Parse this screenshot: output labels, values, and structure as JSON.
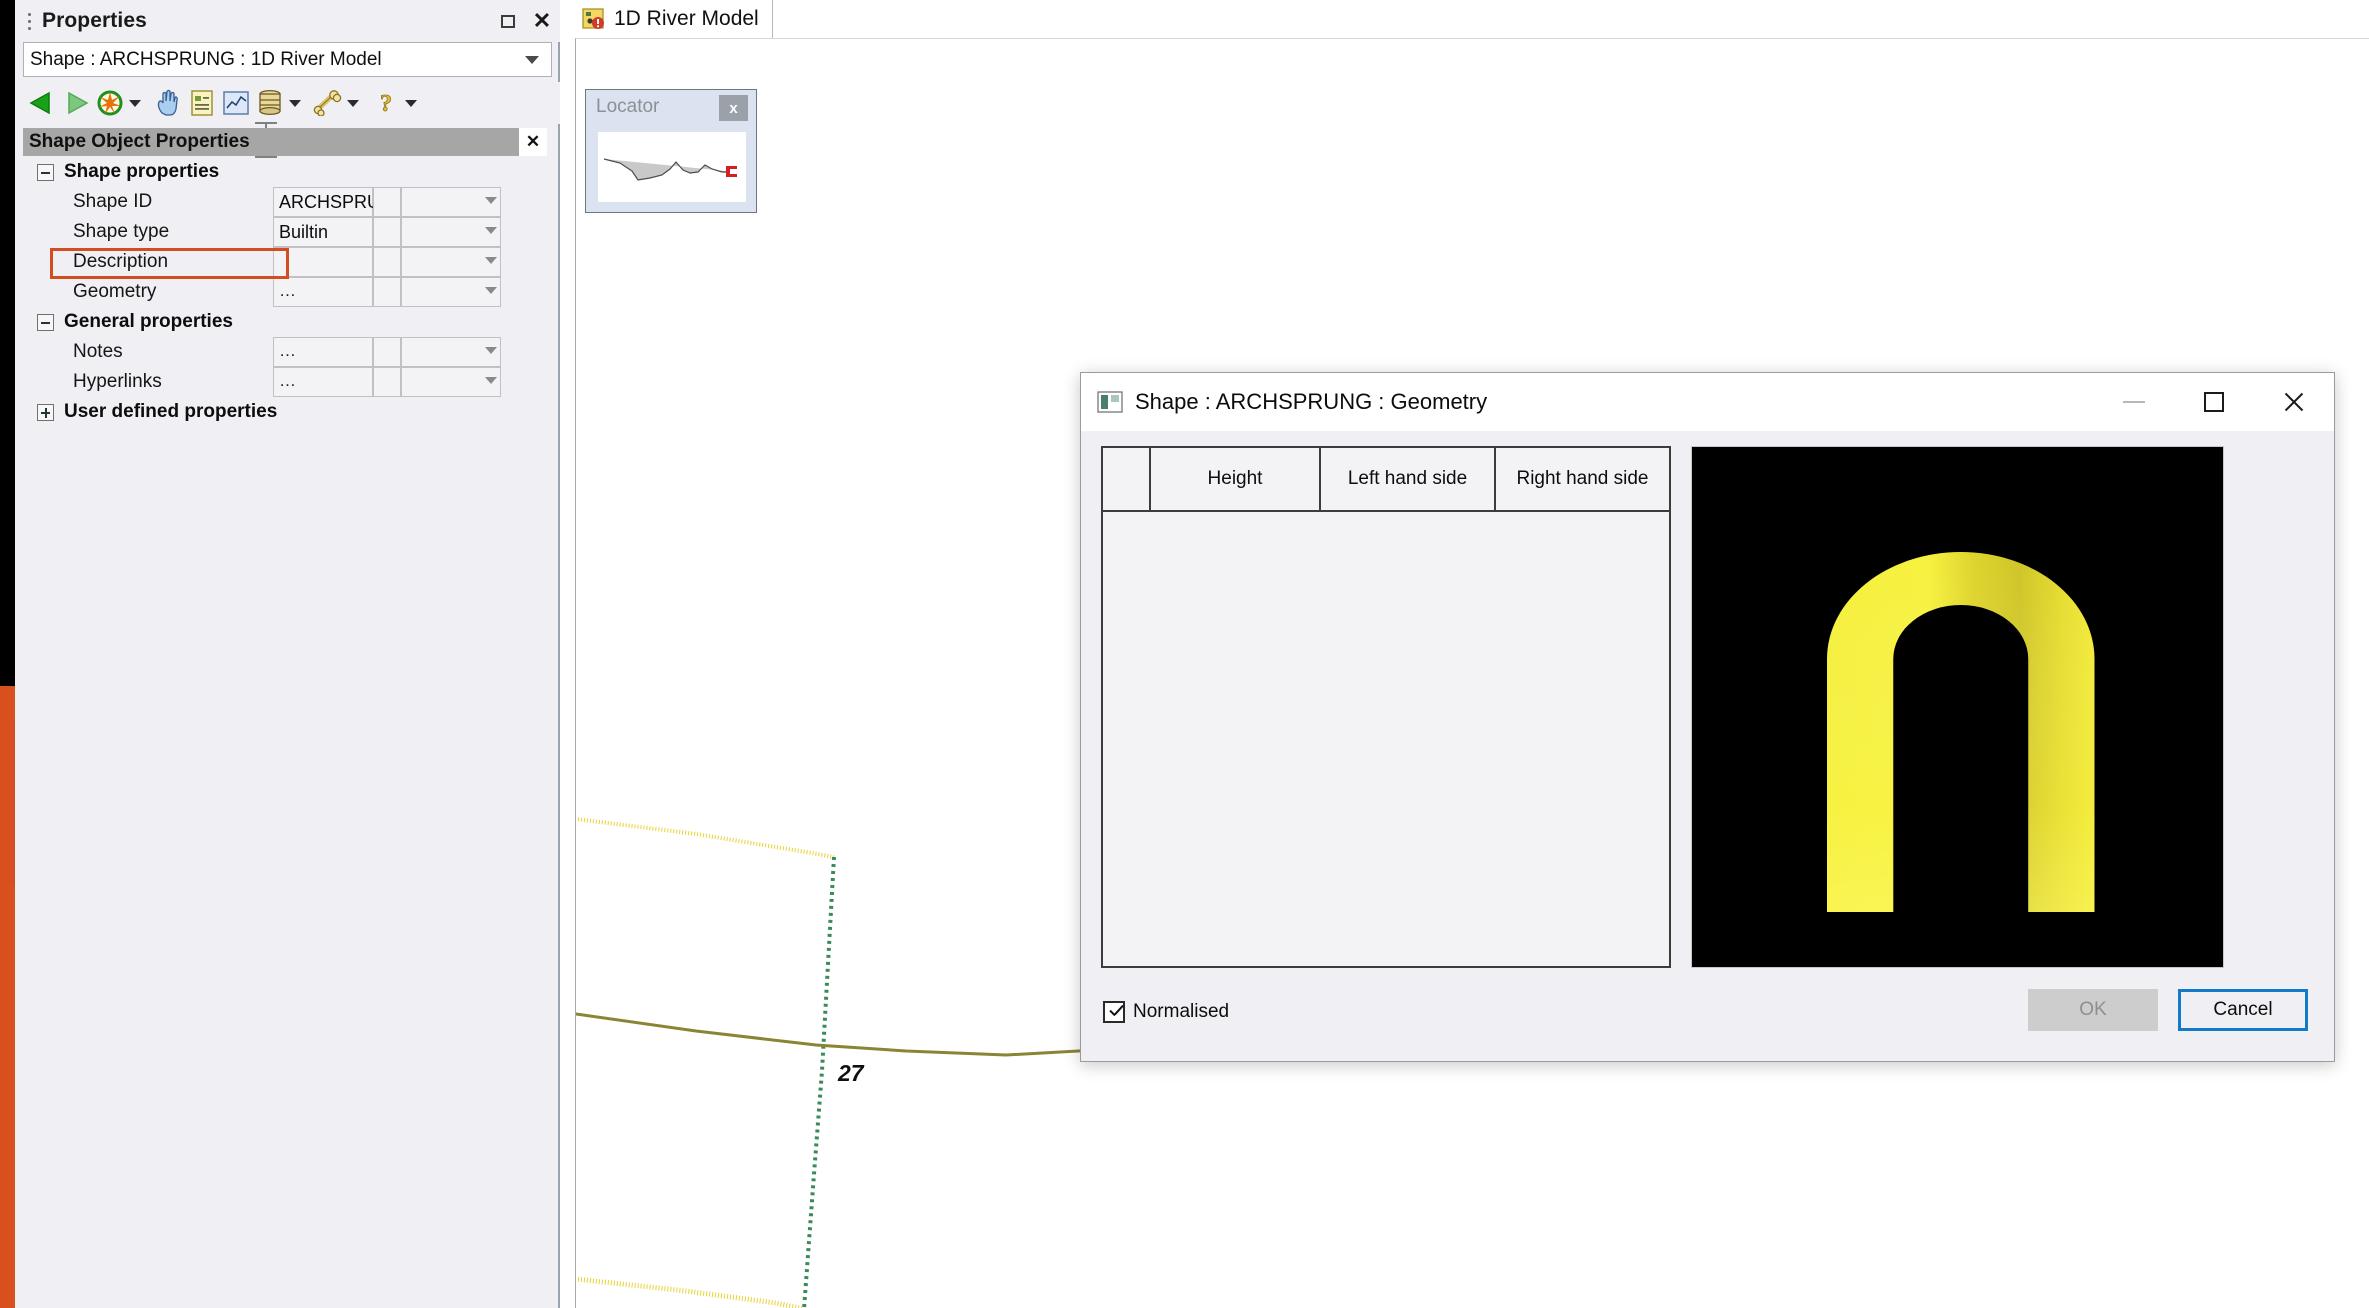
{
  "properties_panel": {
    "title": "Properties",
    "grip_icon": "grip-dots-icon",
    "restore_icon": "restore-icon",
    "close_icon": "close-icon",
    "object_selector": {
      "value": "Shape : ARCHSPRUNG : 1D River Model",
      "chevron_icon": "chevron-down-icon"
    },
    "toolbar": [
      {
        "name": "back-icon",
        "label": "Back"
      },
      {
        "name": "forward-icon",
        "label": "Forward"
      },
      {
        "name": "target-icon",
        "label": "Locate",
        "has_dropdown": true
      },
      {
        "name": "hand-icon",
        "label": "Pan"
      },
      {
        "name": "document-icon",
        "label": "Report"
      },
      {
        "name": "chart-icon",
        "label": "Graph"
      },
      {
        "name": "database-icon",
        "label": "Data",
        "has_dropdown": true
      },
      {
        "name": "bone-icon",
        "label": "Tools",
        "has_dropdown": true
      },
      {
        "name": "help-icon",
        "label": "Help",
        "has_dropdown": true
      }
    ],
    "object_props_header": {
      "title": "Shape Object Properties",
      "close_icon": "close-icon"
    },
    "groups": [
      {
        "label": "Shape properties",
        "expanded": true,
        "rows": [
          {
            "label": "Shape ID",
            "value": "ARCHSPRUNG",
            "ellipsis": false,
            "highlighted": false
          },
          {
            "label": "Shape type",
            "value": "Builtin",
            "ellipsis": false,
            "highlighted": false
          },
          {
            "label": "Description",
            "value": "",
            "ellipsis": false,
            "highlighted": false
          },
          {
            "label": "Geometry",
            "value": "",
            "ellipsis": true,
            "highlighted": true
          }
        ]
      },
      {
        "label": "General properties",
        "expanded": true,
        "rows": [
          {
            "label": "Notes",
            "value": "",
            "ellipsis": true,
            "highlighted": false
          },
          {
            "label": "Hyperlinks",
            "value": "",
            "ellipsis": true,
            "highlighted": false
          }
        ]
      },
      {
        "label": "User defined properties",
        "expanded": false,
        "rows": []
      }
    ],
    "ellipsis_glyph": "…",
    "highlight_color": "#d24d21"
  },
  "main": {
    "tab": {
      "label": "1D River Model",
      "icon": "model-warning-icon"
    },
    "locator": {
      "title": "Locator",
      "close_label": "x",
      "close_icon": "close-icon",
      "thumbnail_icon": "long-section-thumbnail"
    },
    "map": {
      "section_label": "27"
    }
  },
  "dialog": {
    "title": "Shape : ARCHSPRUNG : Geometry",
    "icon": "shape-geometry-icon",
    "minimize_icon": "minimize-icon",
    "maximize_icon": "maximize-icon",
    "close_icon": "close-icon",
    "table": {
      "columns": [
        "",
        "Height",
        "Left hand side",
        "Right hand side"
      ],
      "rows": []
    },
    "preview": {
      "background_color": "#000000",
      "shape_color": "#f2e830",
      "shape_name": "arch-sprung-preview"
    },
    "normalised": {
      "label": "Normalised",
      "checked": true
    },
    "buttons": {
      "ok": {
        "label": "OK",
        "enabled": false
      },
      "cancel": {
        "label": "Cancel",
        "enabled": true,
        "focused": true
      }
    }
  },
  "annotation": {
    "edge_strip_color": "#d9501f",
    "rect_border_color": "#d24d21"
  }
}
